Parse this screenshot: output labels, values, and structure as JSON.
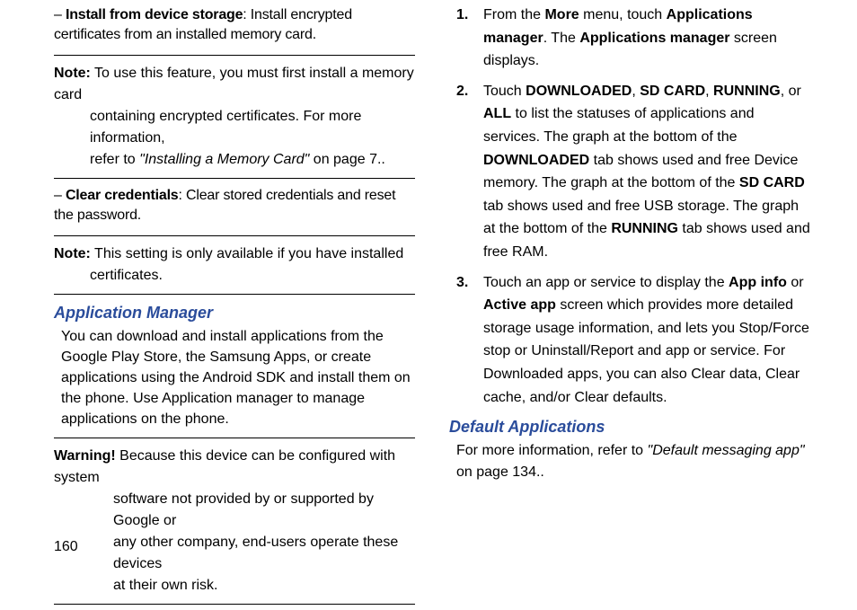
{
  "left": {
    "dash1": {
      "lead": "Install from device storage",
      "rest": ": Install encrypted certificates from an installed memory card."
    },
    "note1": {
      "label": "Note:",
      "line1_a": " To use this feature, you must first install a memory card",
      "line2": "containing encrypted certificates. For more information,",
      "line3_a": "refer to ",
      "line3_ital": "\"Installing a Memory Card\"",
      "line3_b": " on page 7.."
    },
    "dash2": {
      "lead": "Clear credentials",
      "rest": ": Clear stored credentials and reset the password."
    },
    "note2": {
      "label": "Note:",
      "line1_a": " This setting is only available if you have installed",
      "line2": "certificates."
    },
    "appmgr_heading": "Application Manager",
    "appmgr_para": "You can download and install applications from the Google Play Store, the Samsung Apps, or create applications using the Android SDK and install them on the phone. Use Application manager to manage applications on the phone.",
    "warning": {
      "label": "Warning!",
      "line1_a": " Because this device can be configured with system",
      "line2": "software not provided by or supported by Google or",
      "line3": "any other company, end-users operate these devices",
      "line4": "at their own risk."
    }
  },
  "right": {
    "step1_a": "From the ",
    "step1_more": "More",
    "step1_b": " menu, touch ",
    "step1_appsmgr": "Applications manager",
    "step1_c": ". The ",
    "step1_appsmgr2": "Applications manager",
    "step1_d": " screen displays.",
    "step2_a": "Touch ",
    "step2_dl": "DOWNLOADED",
    "step2_b": ", ",
    "step2_sd": "SD CARD",
    "step2_c": ", ",
    "step2_run": "RUNNING",
    "step2_d": ", or ",
    "step2_all": "ALL",
    "step2_e": " to list the statuses of applications and services. The graph at the bottom of the ",
    "step2_dl2": "DOWNLOADED",
    "step2_f": " tab shows used and free Device memory. The graph at the bottom of the ",
    "step2_sd2": "SD CARD",
    "step2_g": " tab shows used and free USB storage. The graph at the bottom of the ",
    "step2_run2": "RUNNING",
    "step2_h": " tab shows used and free RAM.",
    "step3_a": "Touch an app or service to display the ",
    "step3_appinfo": "App info",
    "step3_b": " or ",
    "step3_activeapp": "Active app",
    "step3_c": " screen which provides more detailed storage usage information, and lets you Stop/Force stop or Uninstall/Report and app or service. For Downloaded apps, you can also Clear data, Clear cache, and/or Clear defaults.",
    "defapp_heading": "Default Applications",
    "defapp_a": "For more information, refer to ",
    "defapp_ital": "\"Default messaging app\"",
    "defapp_b": " on page 134.."
  },
  "page_number": "160"
}
